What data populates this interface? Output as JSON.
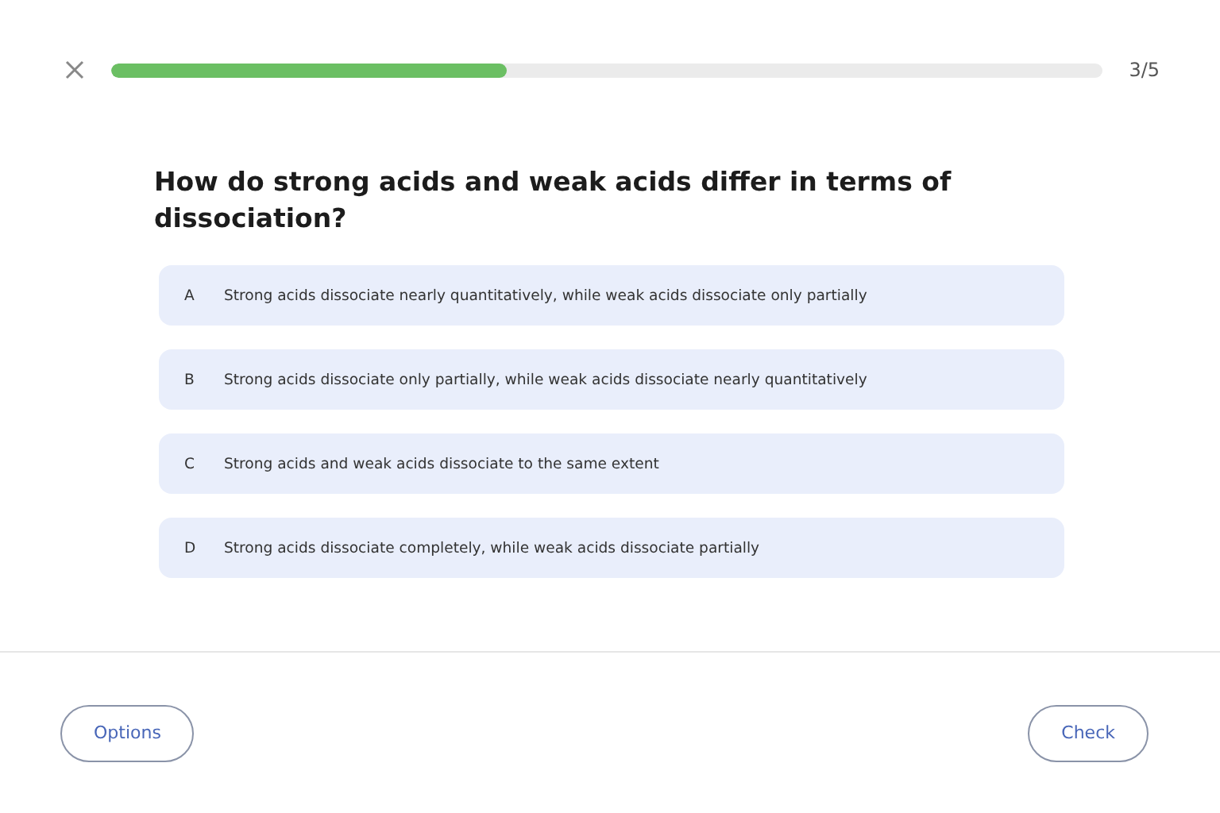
{
  "progress": {
    "level": 0.4,
    "counter": "3/5"
  },
  "question": "How do strong acids and weak acids differ in terms of dissociation?",
  "options": [
    {
      "letter": "A",
      "text": "Strong acids dissociate nearly quantitatively, while weak acids dissociate only partially",
      "selected": false
    },
    {
      "letter": "B",
      "text": "Strong acids dissociate only partially, while weak acids dissociate nearly quantitatively",
      "selected": false
    },
    {
      "letter": "C",
      "text": "Strong acids and weak acids dissociate to the same extent",
      "selected": false
    },
    {
      "letter": "D",
      "text": "Strong acids dissociate completely, while weak acids dissociate partially",
      "selected": false
    }
  ],
  "footer": {
    "options_button": "Options",
    "check_button": "Check"
  }
}
